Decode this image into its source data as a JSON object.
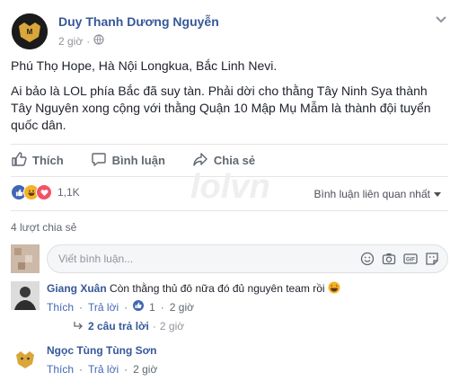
{
  "post": {
    "author": "Duy Thanh Dương Nguyễn",
    "time": "2 giờ",
    "paragraphs": [
      "Phú Thọ Hope, Hà Nội Longkua, Bắc Linh Nevi.",
      "Ai bảo là LOL phía Bắc đã suy tàn. Phải dời cho thằng Tây Ninh Sya thành Tây Nguyên xong cộng với thằng Quận 10 Mập Mụ Mẫm là thành đội tuyển quốc dân."
    ]
  },
  "actions": {
    "like": "Thích",
    "comment": "Bình luận",
    "share": "Chia sẻ"
  },
  "reactions": {
    "count": "1,1K",
    "sort_label": "Bình luận liên quan nhất"
  },
  "watermark": "lolvn",
  "shares_text": "4 lượt chia sẻ",
  "composer": {
    "placeholder": "Viết bình luận..."
  },
  "comments": [
    {
      "name": "Giang Xuân",
      "text": "Còn thằng thủ đô nữa đó đủ nguyên team rồi",
      "like": "Thích",
      "reply": "Trả lời",
      "like_count": "1",
      "time": "2 giờ",
      "replies_text": "2 câu trả lời",
      "replies_time": "2 giờ"
    },
    {
      "name": "Ngọc Tùng Tùng Sơn",
      "like": "Thích",
      "reply": "Trả lời",
      "time": "2 giờ"
    }
  ],
  "colors": {
    "link": "#365899",
    "like_blue": "#4267b2",
    "haha_yellow": "#f7b125",
    "love_red": "#f25268"
  }
}
